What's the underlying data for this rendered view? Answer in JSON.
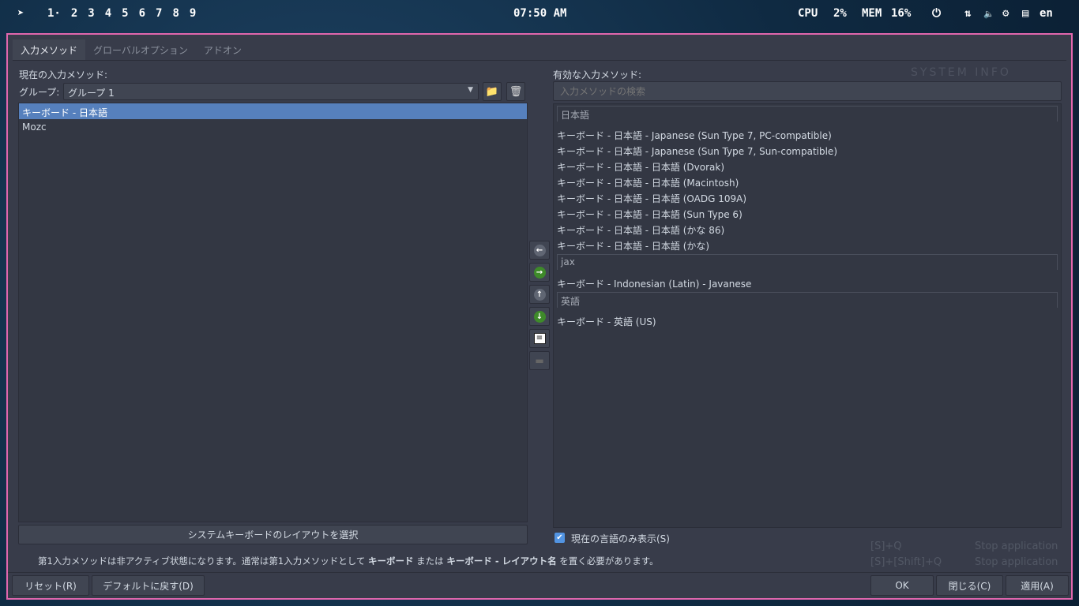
{
  "topbar": {
    "workspaces": [
      "1·",
      "2",
      "3",
      "4",
      "5",
      "6",
      "7",
      "8",
      "9"
    ],
    "clock": "07:50 AM",
    "cpu_label": "CPU",
    "cpu": "2%",
    "mem_label": "MEM",
    "mem": "16%",
    "lang": "en"
  },
  "tabs": [
    "入力メソッド",
    "グローバルオプション",
    "アドオン"
  ],
  "left": {
    "title": "現在の入力メソッド:",
    "group_label": "グループ:",
    "group_value": "グループ 1",
    "items": [
      "キーボード - 日本語",
      "Mozc"
    ],
    "layout_button": "システムキーボードのレイアウトを選択"
  },
  "right": {
    "title": "有効な入力メソッド:",
    "search_placeholder": "入力メソッドの検索",
    "groups": [
      {
        "name": "日本語",
        "items": [
          "キーボード - 日本語 - Japanese (Sun Type 7, PC-compatible)",
          "キーボード - 日本語 - Japanese (Sun Type 7, Sun-compatible)",
          "キーボード - 日本語 - 日本語 (Dvorak)",
          "キーボード - 日本語 - 日本語 (Macintosh)",
          "キーボード - 日本語 - 日本語 (OADG 109A)",
          "キーボード - 日本語 - 日本語 (Sun Type 6)",
          "キーボード - 日本語 - 日本語 (かな 86)",
          "キーボード - 日本語 - 日本語 (かな)"
        ]
      },
      {
        "name": "jax",
        "items": [
          "キーボード - Indonesian (Latin) - Javanese"
        ]
      },
      {
        "name": "英語",
        "items": [
          "キーボード - 英語 (US)"
        ]
      }
    ],
    "only_current_lang": "現在の言語のみ表示(S)"
  },
  "note": {
    "p1": "第1入力メソッドは非アクティブ状態になります。通常は第1入力メソッドとして ",
    "b1": "キーボード",
    "p2": " または ",
    "b2": "キーボード - レイアウト名",
    "p3": " を置く必要があります。"
  },
  "buttons": {
    "reset": "リセット(R)",
    "default": "デフォルトに戻す(D)",
    "ok": "OK",
    "close": "閉じる(C)",
    "apply": "適用(A)"
  },
  "background": {
    "sysinfo": "SYSTEM INFO",
    "k1": "[S]+Q",
    "a1": "Stop application",
    "k2": "[S]+[Shift]+Q",
    "a2": "Stop application"
  }
}
